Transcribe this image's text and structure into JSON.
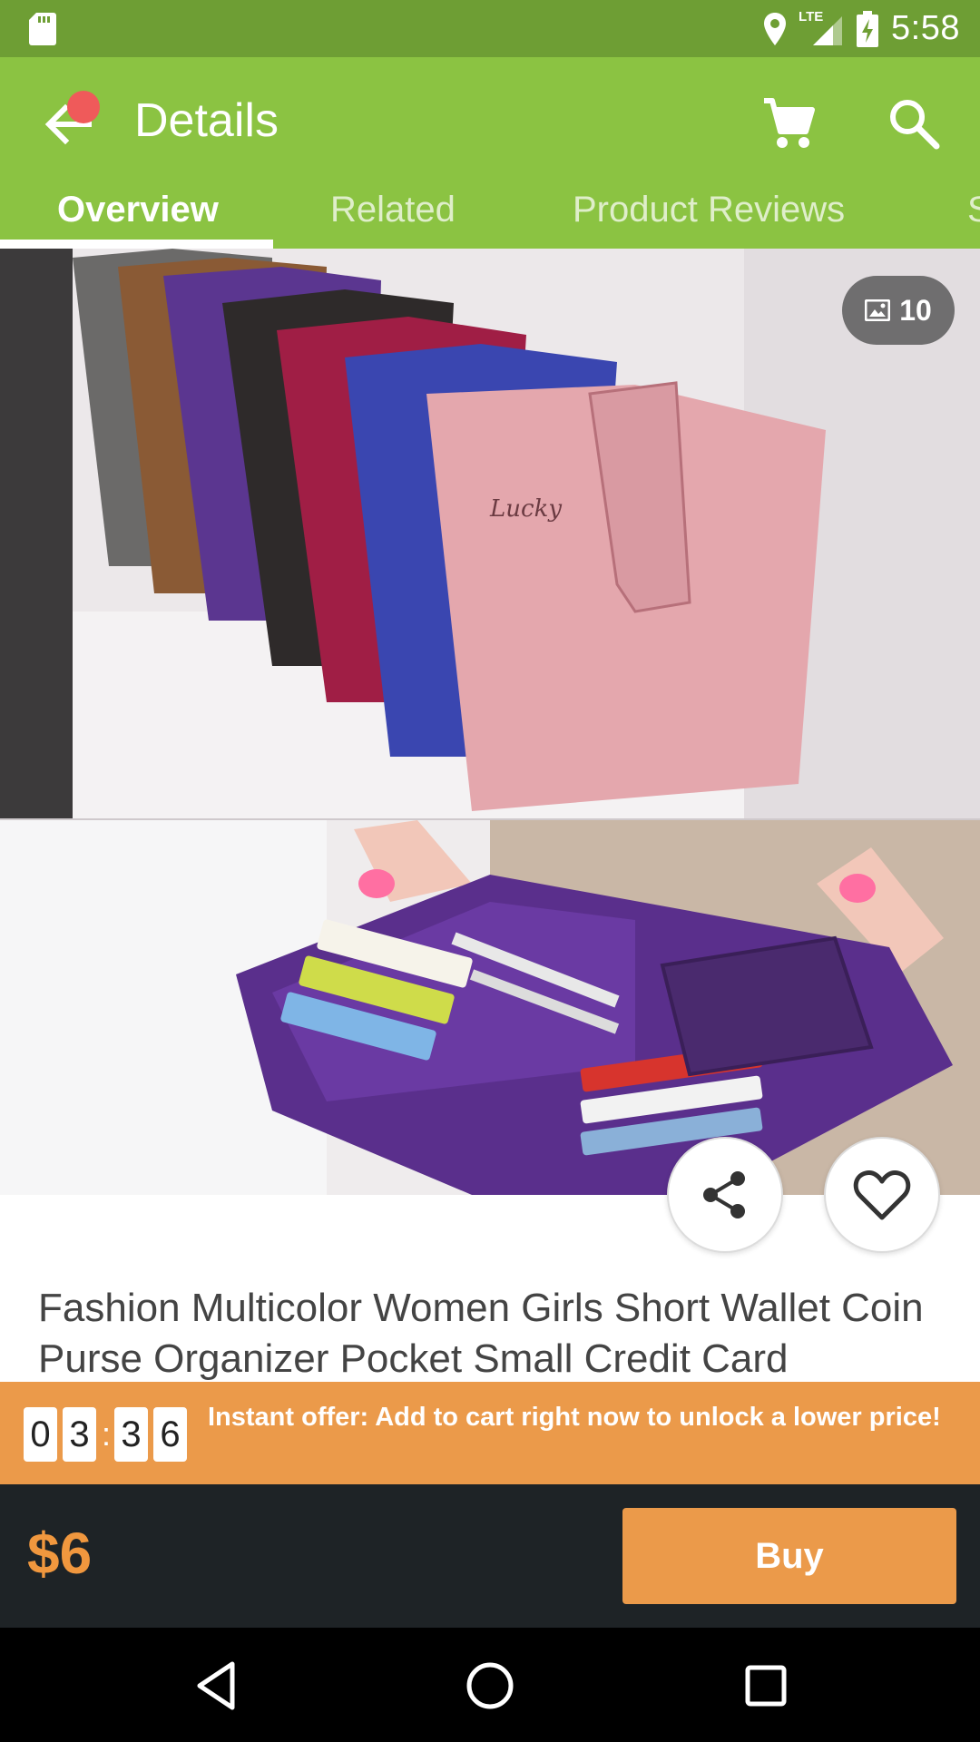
{
  "status_bar": {
    "time": "5:58",
    "network": "LTE",
    "icons": [
      "sd-card-icon",
      "location-icon",
      "signal-icon",
      "battery-charging-icon"
    ]
  },
  "app_bar": {
    "title": "Details",
    "icons": [
      "back-arrow-icon",
      "cart-icon",
      "search-icon"
    ],
    "notification_color": "#ef5a5a"
  },
  "tabs": [
    {
      "label": "Overview",
      "active": true
    },
    {
      "label": "Related",
      "active": false
    },
    {
      "label": "Product Reviews",
      "active": false
    },
    {
      "label": "S",
      "active": false
    }
  ],
  "gallery": {
    "photo_count": "10",
    "icon": "image-icon"
  },
  "actions": {
    "share_icon": "share-icon",
    "favorite_icon": "heart-icon"
  },
  "product": {
    "title": "Fashion Multicolor Women Girls Short Wallet Coin Purse Organizer Pocket Small Credit Card"
  },
  "offer": {
    "countdown": [
      "0",
      "3",
      "3",
      "6"
    ],
    "separator": ":",
    "text": "Instant offer: Add to cart right now to unlock a lower price!"
  },
  "purchase": {
    "price": "$6",
    "buy_label": "Buy"
  },
  "nav_bar": {
    "icons": [
      "nav-back-icon",
      "nav-home-icon",
      "nav-recents-icon"
    ]
  },
  "colors": {
    "status_bar": "#6e9e34",
    "app_bar": "#8bc342",
    "accent_orange": "#eb9a4a",
    "price_orange": "#f0973e",
    "bottom_bar": "#1e2326"
  }
}
